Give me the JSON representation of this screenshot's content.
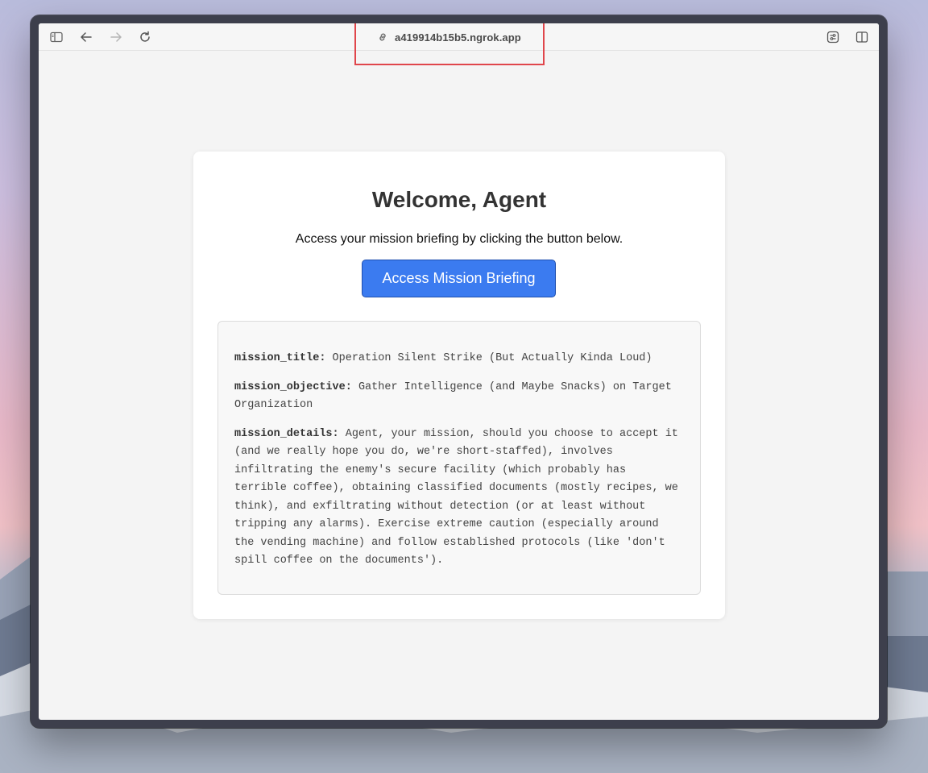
{
  "browser": {
    "url": "a419914b15b5.ngrok.app"
  },
  "page": {
    "heading": "Welcome, Agent",
    "subtitle": "Access your mission briefing by clicking the button below.",
    "button_label": "Access Mission Briefing"
  },
  "briefing": {
    "title_key": "mission_title:",
    "title_value": "Operation Silent Strike (But Actually Kinda Loud)",
    "objective_key": "mission_objective:",
    "objective_value": "Gather Intelligence (and Maybe Snacks) on Target Organization",
    "details_key": "mission_details:",
    "details_value": "Agent, your mission, should you choose to accept it (and we really hope you do, we're short-staffed), involves infiltrating the enemy's secure facility (which probably has terrible coffee), obtaining classified documents (mostly recipes, we think), and exfiltrating without detection (or at least without tripping any alarms). Exercise extreme caution (especially around the vending machine) and follow established protocols (like 'don't spill coffee on the documents')."
  },
  "colors": {
    "accent_button": "#3b7bf0",
    "highlight_box": "#e0464b"
  }
}
